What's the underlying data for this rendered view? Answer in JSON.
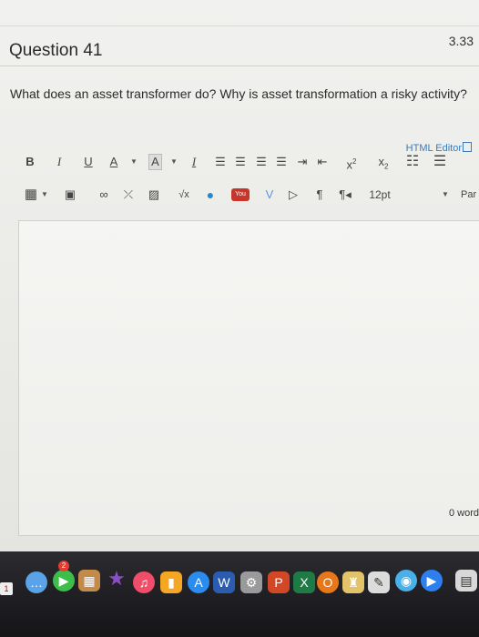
{
  "question": {
    "points": "3.33",
    "title": "Question 41",
    "text": "What does an asset transformer do? Why is asset transformation a risky activity?"
  },
  "editor": {
    "html_editor_label": "HTML Editor",
    "font_size": "12pt",
    "paragraph_label": "Par",
    "word_count": "0 word",
    "content": ""
  },
  "toolbar": {
    "bold": "B",
    "italic": "I",
    "underline": "U",
    "font_color": "A",
    "highlight": "A",
    "clear_format": "I",
    "superscript": "x",
    "subscript": "x",
    "sqrt": "√x",
    "youtube": "You"
  },
  "dock": {
    "badge": "1",
    "notif": "2"
  },
  "icons": {
    "bold": "bold-icon",
    "italic": "italic-icon",
    "underline": "underline-icon",
    "font_color": "font-color-icon",
    "highlight": "highlight-icon",
    "clear": "clear-formatting-icon",
    "align_left": "align-left-icon",
    "align_center": "align-center-icon",
    "align_right": "align-right-icon",
    "justify": "justify-icon",
    "indent": "indent-icon",
    "superscript": "superscript-icon",
    "subscript": "subscript-icon",
    "bullet_list": "bullet-list-icon",
    "numbered_list": "numbered-list-icon",
    "table": "table-icon",
    "media": "media-icon",
    "link": "link-icon",
    "unlink": "unlink-icon",
    "image": "image-icon",
    "math": "math-icon",
    "cloud": "cloud-icon",
    "youtube": "youtube-icon",
    "vimeo": "vimeo-icon",
    "embed": "embed-icon",
    "ltr": "ltr-icon",
    "rtl": "rtl-icon"
  },
  "colors": {
    "link": "#3d7ab8",
    "background": "#ebebe8"
  }
}
